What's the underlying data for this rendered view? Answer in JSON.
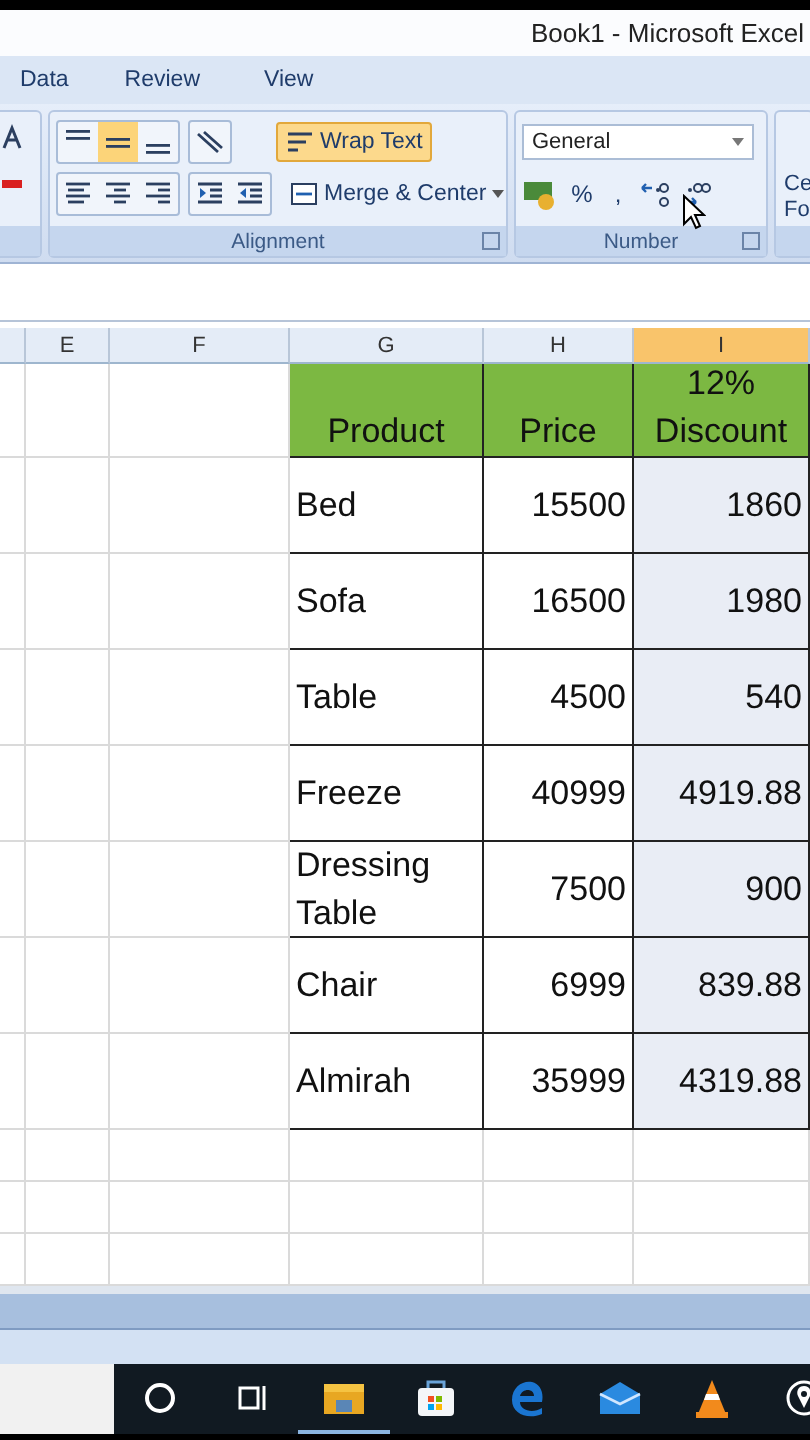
{
  "window": {
    "title": "Book1 - Microsoft Excel"
  },
  "ribbon_tabs": [
    {
      "label": "Data"
    },
    {
      "label": "Review"
    },
    {
      "label": "View"
    }
  ],
  "alignment_group": {
    "label": "Alignment",
    "vertical_align": [
      {
        "selected": false
      },
      {
        "selected": true
      },
      {
        "selected": false
      }
    ],
    "wrap_text": {
      "label": "Wrap Text",
      "selected": true
    },
    "merge": {
      "label": "Merge & Center"
    }
  },
  "number_group": {
    "label": "Number",
    "format": "General",
    "percent": "%",
    "comma": ","
  },
  "styles_partial": [
    "Ce",
    "Fo"
  ],
  "columns": [
    {
      "label": "E",
      "selected": false
    },
    {
      "label": "F",
      "selected": false
    },
    {
      "label": "G",
      "selected": false
    },
    {
      "label": "H",
      "selected": false
    },
    {
      "label": "I",
      "selected": true
    }
  ],
  "table": {
    "columns": [
      "Product",
      "Price",
      "12% Discount"
    ],
    "rows": [
      [
        "Bed",
        "15500",
        "1860"
      ],
      [
        "Sofa",
        "16500",
        "1980"
      ],
      [
        "Table",
        "4500",
        "540"
      ],
      [
        "Freeze",
        "40999",
        "4919.88"
      ],
      [
        "Dressing Table",
        "7500",
        "900"
      ],
      [
        "Chair",
        "6999",
        "839.88"
      ],
      [
        "Almirah",
        "35999",
        "4319.88"
      ]
    ]
  },
  "taskbar": [
    {
      "kind": "cortana",
      "selected": false
    },
    {
      "kind": "taskview",
      "selected": false
    },
    {
      "kind": "explorer",
      "selected": true
    },
    {
      "kind": "store",
      "selected": false
    },
    {
      "kind": "edge",
      "selected": false
    },
    {
      "kind": "mail",
      "selected": false
    },
    {
      "kind": "vlc",
      "selected": false
    },
    {
      "kind": "maps",
      "selected": false
    }
  ]
}
